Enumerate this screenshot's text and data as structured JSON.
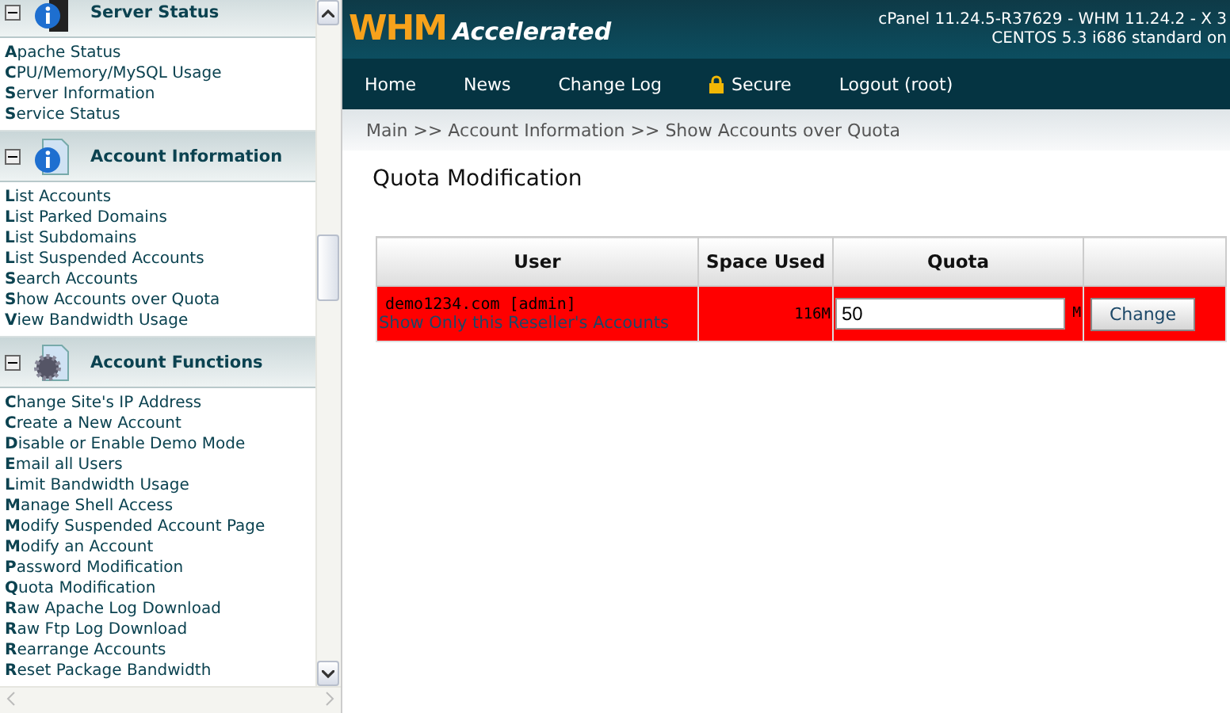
{
  "sidebar": {
    "sections": [
      {
        "title": "Server Status",
        "kind": "server",
        "expanded": true,
        "items": [
          "Apache Status",
          "CPU/Memory/MySQL Usage",
          "Server Information",
          "Service Status"
        ]
      },
      {
        "title": "Account Information",
        "kind": "document",
        "expanded": true,
        "items": [
          "List Accounts",
          "List Parked Domains",
          "List Subdomains",
          "List Suspended Accounts",
          "Search Accounts",
          "Show Accounts over Quota",
          "View Bandwidth Usage"
        ]
      },
      {
        "title": "Account Functions",
        "kind": "gear",
        "expanded": true,
        "items": [
          "Change Site's IP Address",
          "Create a New Account",
          "Disable or Enable Demo Mode",
          "Email all Users",
          "Limit Bandwidth Usage",
          "Manage Shell Access",
          "Modify Suspended Account Page",
          "Modify an Account",
          "Password Modification",
          "Quota Modification",
          "Raw Apache Log Download",
          "Raw Ftp Log Download",
          "Rearrange Accounts",
          "Reset Package Bandwidth"
        ]
      }
    ]
  },
  "header": {
    "logo_main": "WHM",
    "logo_sub": "Accelerated",
    "version_lines": [
      "cPanel 11.24.5-R37629 - WHM 11.24.2 - X 3",
      "CENTOS 5.3 i686 standard on"
    ]
  },
  "nav": [
    {
      "label": "Home",
      "kind": "plain"
    },
    {
      "label": "News",
      "kind": "plain"
    },
    {
      "label": "Change Log",
      "kind": "plain"
    },
    {
      "label": "Secure",
      "kind": "lock"
    },
    {
      "label": "Logout (root)",
      "kind": "plain"
    }
  ],
  "breadcrumb": "Main >> Account Information >> Show Accounts over Quota",
  "page_title": "Quota Modification",
  "table": {
    "columns": [
      "User",
      "Space Used",
      "Quota"
    ],
    "rows": [
      {
        "user": "demo1234.com [admin]",
        "reseller_link": "Show Only this Reseller's Accounts",
        "space_used": "116M",
        "quota": "50",
        "unit": "M",
        "button": "Change",
        "over_quota": true
      }
    ]
  }
}
